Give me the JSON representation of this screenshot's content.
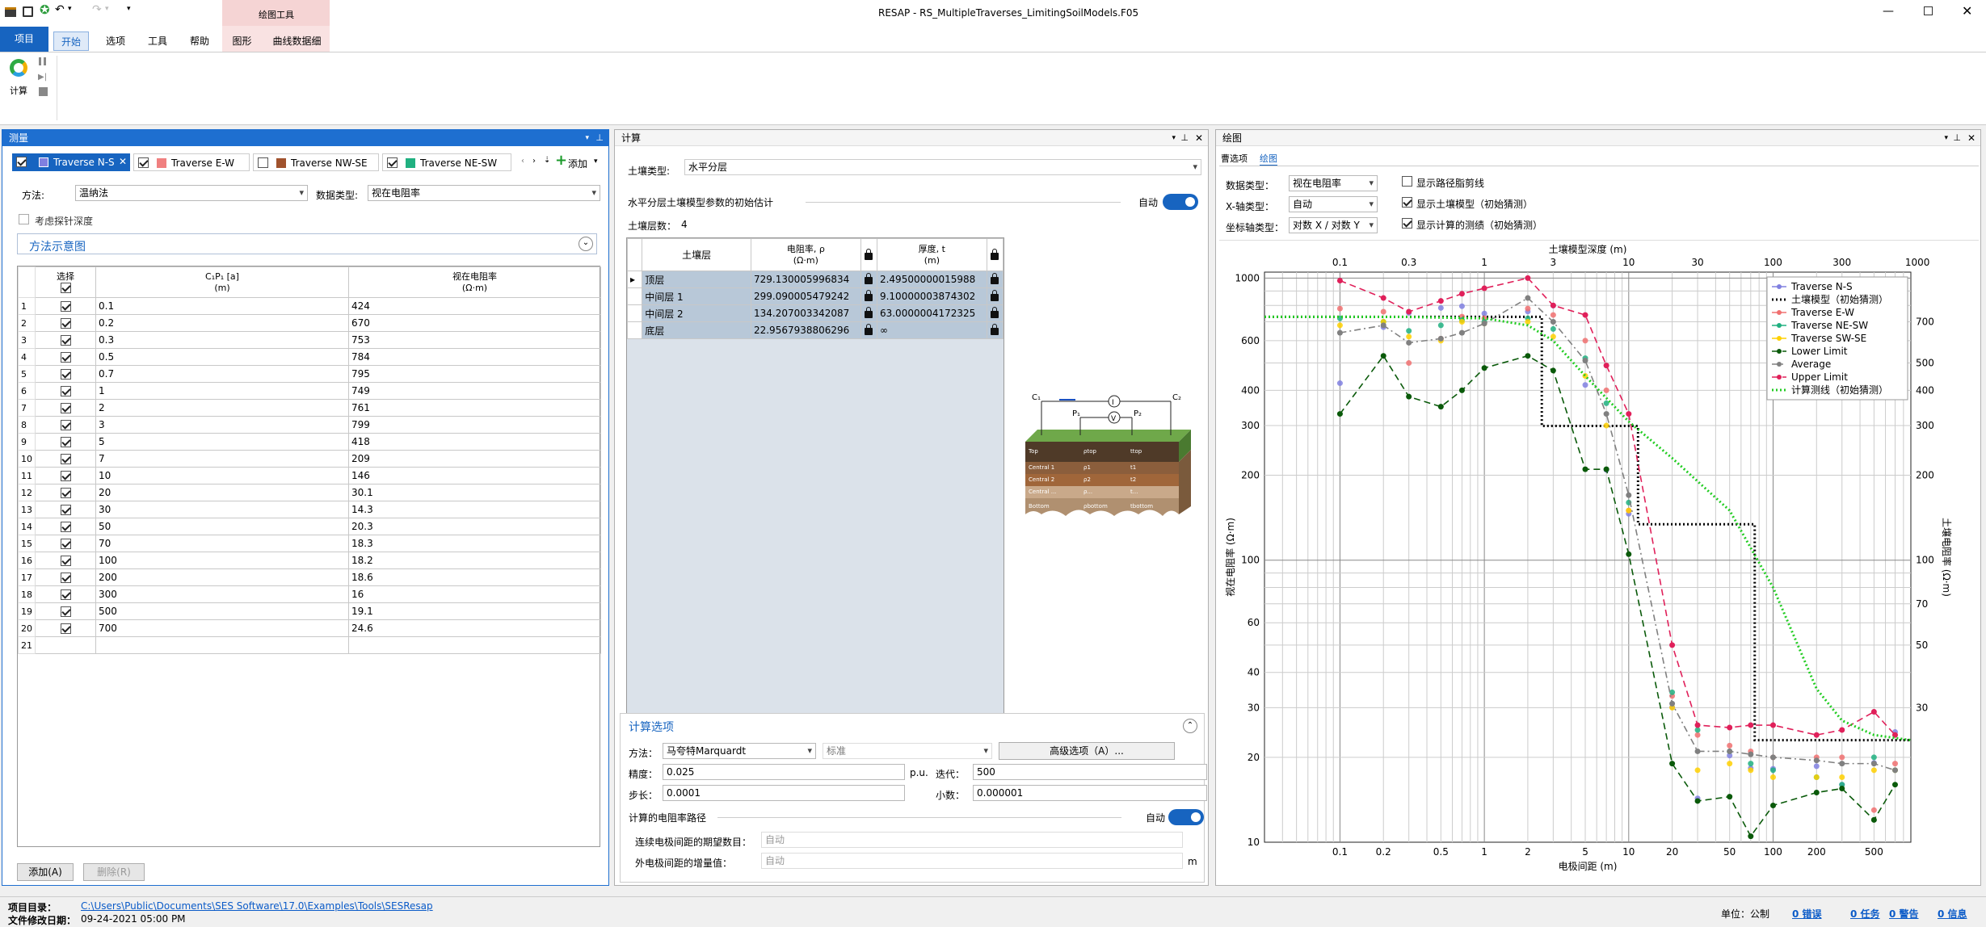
{
  "window": {
    "title": "RESAP - RS_MultipleTraverses_LimitingSoilModels.F05",
    "context_group": "绘图工具"
  },
  "ribbon": {
    "tabs": [
      "项目",
      "开始",
      "选项",
      "工具",
      "帮助",
      "图形",
      "曲线数据细"
    ],
    "calc_label": "计算"
  },
  "measure_panel": {
    "title": "测量",
    "traverse_tabs": [
      {
        "label": "Traverse N-S",
        "checked": true,
        "color": "#8080e0"
      },
      {
        "label": "Traverse E-W",
        "checked": true,
        "color": "#f08080"
      },
      {
        "label": "Traverse NW-SE",
        "checked": false,
        "color": "#a0522d"
      },
      {
        "label": "Traverse NE-SW",
        "checked": true,
        "color": "#20b080"
      }
    ],
    "add_label": "添加",
    "method_label": "方法:",
    "method_value": "温纳法",
    "data_type_label": "数据类型:",
    "data_type_value": "视在电阻率",
    "probe_depth_label": "考虑探针深度",
    "diagram_label": "方法示意图",
    "columns": {
      "select": "选择",
      "spacing": "C₁P₁ [a]",
      "spacing_unit": "(m)",
      "resistivity": "视在电阻率",
      "resistivity_unit": "(Ω·m)"
    },
    "rows": [
      [
        "1",
        "0.1",
        "424"
      ],
      [
        "2",
        "0.2",
        "670"
      ],
      [
        "3",
        "0.3",
        "753"
      ],
      [
        "4",
        "0.5",
        "784"
      ],
      [
        "5",
        "0.7",
        "795"
      ],
      [
        "6",
        "1",
        "749"
      ],
      [
        "7",
        "2",
        "761"
      ],
      [
        "8",
        "3",
        "799"
      ],
      [
        "9",
        "5",
        "418"
      ],
      [
        "10",
        "7",
        "209"
      ],
      [
        "11",
        "10",
        "146"
      ],
      [
        "12",
        "20",
        "30.1"
      ],
      [
        "13",
        "30",
        "14.3"
      ],
      [
        "14",
        "50",
        "20.3"
      ],
      [
        "15",
        "70",
        "18.3"
      ],
      [
        "16",
        "100",
        "18.2"
      ],
      [
        "17",
        "200",
        "18.6"
      ],
      [
        "18",
        "300",
        "16"
      ],
      [
        "19",
        "500",
        "19.1"
      ],
      [
        "20",
        "700",
        "24.6"
      ],
      [
        "21",
        "",
        ""
      ]
    ],
    "add_button": "添加(A)",
    "delete_button": "删除(R)"
  },
  "calc_panel": {
    "title": "计算",
    "soil_type_label": "土壤类型:",
    "soil_type_value": "水平分层",
    "initial_estimate_label": "水平分层土壤模型参数的初始估计",
    "auto_label": "自动",
    "layer_count_label": "土壤层数：",
    "layer_count_value": "4",
    "columns": {
      "layer": "土壤层",
      "rho": "电阻率, ρ",
      "rho_unit": "(Ω·m)",
      "thick": "厚度, t",
      "thick_unit": "(m)"
    },
    "layers": [
      [
        "顶层",
        "729.130005996834",
        "2.49500000015988"
      ],
      [
        "中间层 1",
        "299.090005479242",
        "9.10000003874302"
      ],
      [
        "中间层 2",
        "134.207003342087",
        "63.0000004172325"
      ],
      [
        "底层",
        "22.9567938806296",
        "∞"
      ]
    ],
    "diagram": {
      "c1": "C₁",
      "c2": "C₂",
      "p1": "P₁",
      "p2": "P₂",
      "i": "I",
      "v": "V",
      "layers": [
        "Top",
        "Central 1",
        "Central 2",
        "Central ...",
        "Bottom"
      ],
      "rho": [
        "ρtop",
        "ρ1",
        "ρ2",
        "ρ...",
        "ρbottom"
      ],
      "t": [
        "ttop",
        "t1",
        "t2",
        "t...",
        "tbottom"
      ]
    },
    "options_title": "计算选项",
    "method_label": "方法：",
    "method_value": "马夸特Marquardt",
    "standard_value": "标准",
    "advanced_button": "高级选项（A）...",
    "precision_label": "精度：",
    "precision_value": "0.025",
    "precision_unit": "p.u.",
    "iter_label": "迭代：",
    "iter_value": "500",
    "step_label": "步长：",
    "step_value": "0.0001",
    "decimal_label": "小数：",
    "decimal_value": "0.000001",
    "path_label": "计算的电阻率路径",
    "path_auto": "自动",
    "electrode_count_label": "连续电极间距的期望数目：",
    "electrode_count_value": "自动",
    "outer_increment_label": "外电极间距的增量值：",
    "outer_increment_value": "自动",
    "outer_increment_unit": "m"
  },
  "plot_panel": {
    "title": "绘图",
    "tabs": [
      "曹选项",
      "绘图"
    ],
    "data_type_label": "数据类型：",
    "data_type_value": "视在电阻率",
    "x_axis_label": "X-轴类型：",
    "x_axis_value": "自动",
    "coord_label": "坐标轴类型：",
    "coord_value": "对数 X / 对数 Y",
    "check_path": "显示路径脂剪线",
    "check_model": "显示土壤模型（初始猜测）",
    "check_calc": "显示计算的测绩（初始猜测）",
    "checks_state": [
      false,
      true,
      true
    ]
  },
  "chart_data": {
    "type": "line",
    "xlabel": "电极间距 (m)",
    "ylabel": "视在电阻率 (Ω·m)",
    "x2label": "土壤模型深度 (m)",
    "y2label": "土壤电阻率 (Ω·m)",
    "xlim": [
      0.03,
      900
    ],
    "ylim": [
      10,
      1050
    ],
    "log_x": true,
    "log_y": true,
    "xticks": [
      "0.1",
      "0.2",
      "0.5",
      "1",
      "2",
      "5",
      "10",
      "20",
      "50",
      "100",
      "200",
      "500"
    ],
    "yticks": [
      "10",
      "20",
      "30",
      "40",
      "60",
      "100",
      "200",
      "300",
      "400",
      "600",
      "1000"
    ],
    "x2ticks": [
      "0.1",
      "0.3",
      "1",
      "3",
      "10",
      "30",
      "100",
      "300",
      "1000"
    ],
    "y2ticks": [
      "30",
      "50",
      "70",
      "100",
      "200",
      "300",
      "400",
      "500",
      "700"
    ],
    "legend_position": "top-right",
    "series": [
      {
        "name": "Traverse N-S",
        "style": "dots",
        "color": "#8080e0",
        "x": [
          0.1,
          0.2,
          0.3,
          0.5,
          0.7,
          1,
          2,
          3,
          5,
          7,
          10,
          20,
          30,
          50,
          70,
          100,
          200,
          300,
          500,
          700
        ],
        "y": [
          424,
          670,
          753,
          784,
          795,
          749,
          761,
          799,
          418,
          209,
          146,
          30.1,
          14.3,
          20.3,
          18.3,
          18.2,
          18.6,
          16,
          19.1,
          24.6
        ]
      },
      {
        "name": "土壤模型（初始猜测）",
        "style": "dotted",
        "color": "#000000",
        "x": [
          0.03,
          2.5,
          2.5,
          11.6,
          11.6,
          74.6,
          74.6,
          900
        ],
        "y": [
          729,
          729,
          299,
          299,
          134,
          134,
          23,
          23
        ]
      },
      {
        "name": "Traverse E-W",
        "style": "dots",
        "color": "#f07070",
        "x": [
          0.1,
          0.2,
          0.3,
          0.5,
          0.7,
          1,
          2,
          3,
          5,
          7,
          10,
          20,
          30,
          50,
          70,
          100,
          200,
          300,
          500,
          700
        ],
        "y": [
          780,
          760,
          500,
          610,
          730,
          720,
          780,
          740,
          600,
          400,
          150,
          33,
          24,
          22,
          21,
          20,
          20,
          20,
          13,
          19
        ]
      },
      {
        "name": "Traverse NE-SW",
        "style": "dots",
        "color": "#20b080",
        "x": [
          0.1,
          0.2,
          0.3,
          0.5,
          0.7,
          1,
          2,
          3,
          5,
          7,
          10,
          20,
          30,
          50,
          70,
          100,
          200,
          300,
          500,
          700
        ],
        "y": [
          720,
          700,
          650,
          680,
          710,
          700,
          720,
          660,
          520,
          360,
          160,
          34,
          25,
          21,
          19,
          18,
          17,
          16,
          20,
          18
        ]
      },
      {
        "name": "Traverse SW-SE",
        "style": "dots",
        "color": "#ffd000",
        "x": [
          0.1,
          0.2,
          0.3,
          0.5,
          0.7,
          1,
          2,
          3,
          5,
          7,
          10,
          20,
          30,
          50,
          70,
          100,
          200,
          300,
          500,
          700
        ],
        "y": [
          680,
          700,
          620,
          600,
          700,
          690,
          700,
          620,
          450,
          300,
          150,
          30,
          18,
          19,
          18,
          17,
          17,
          17,
          18,
          18
        ]
      },
      {
        "name": "Lower Limit",
        "style": "dashed",
        "color": "#0a5a0a",
        "x": [
          0.1,
          0.2,
          0.3,
          0.5,
          0.7,
          1,
          2,
          3,
          5,
          7,
          10,
          20,
          30,
          50,
          70,
          100,
          200,
          300,
          500,
          700
        ],
        "y": [
          330,
          530,
          380,
          350,
          400,
          480,
          530,
          470,
          210,
          210,
          105,
          19,
          14,
          14.5,
          10.5,
          13.5,
          15,
          15.5,
          12,
          16
        ]
      },
      {
        "name": "Average",
        "style": "dashdot",
        "color": "#808080",
        "x": [
          0.1,
          0.2,
          0.3,
          0.5,
          0.7,
          1,
          2,
          3,
          5,
          7,
          10,
          20,
          30,
          50,
          70,
          100,
          200,
          300,
          500,
          700
        ],
        "y": [
          640,
          680,
          590,
          610,
          640,
          690,
          850,
          700,
          510,
          330,
          170,
          31,
          21,
          21,
          20.5,
          20,
          19.5,
          19,
          19,
          18
        ]
      },
      {
        "name": "Upper Limit",
        "style": "dashed",
        "color": "#e0205a",
        "x": [
          0.1,
          0.2,
          0.3,
          0.5,
          0.7,
          1,
          2,
          3,
          5,
          7,
          10,
          20,
          30,
          50,
          70,
          100,
          200,
          300,
          500,
          700
        ],
        "y": [
          980,
          850,
          760,
          830,
          880,
          920,
          1000,
          800,
          740,
          490,
          330,
          50,
          26,
          25.5,
          26,
          26,
          24,
          25,
          29,
          24
        ]
      },
      {
        "name": "计算测线（初始猜测）",
        "style": "dotted",
        "color": "#22cc22",
        "x": [
          0.03,
          0.1,
          0.3,
          1,
          2,
          3,
          5,
          10,
          20,
          50,
          100,
          200,
          300,
          500,
          900
        ],
        "y": [
          729,
          729,
          728,
          720,
          680,
          600,
          450,
          310,
          230,
          150,
          80,
          35,
          27,
          24,
          23
        ]
      }
    ]
  }
}
